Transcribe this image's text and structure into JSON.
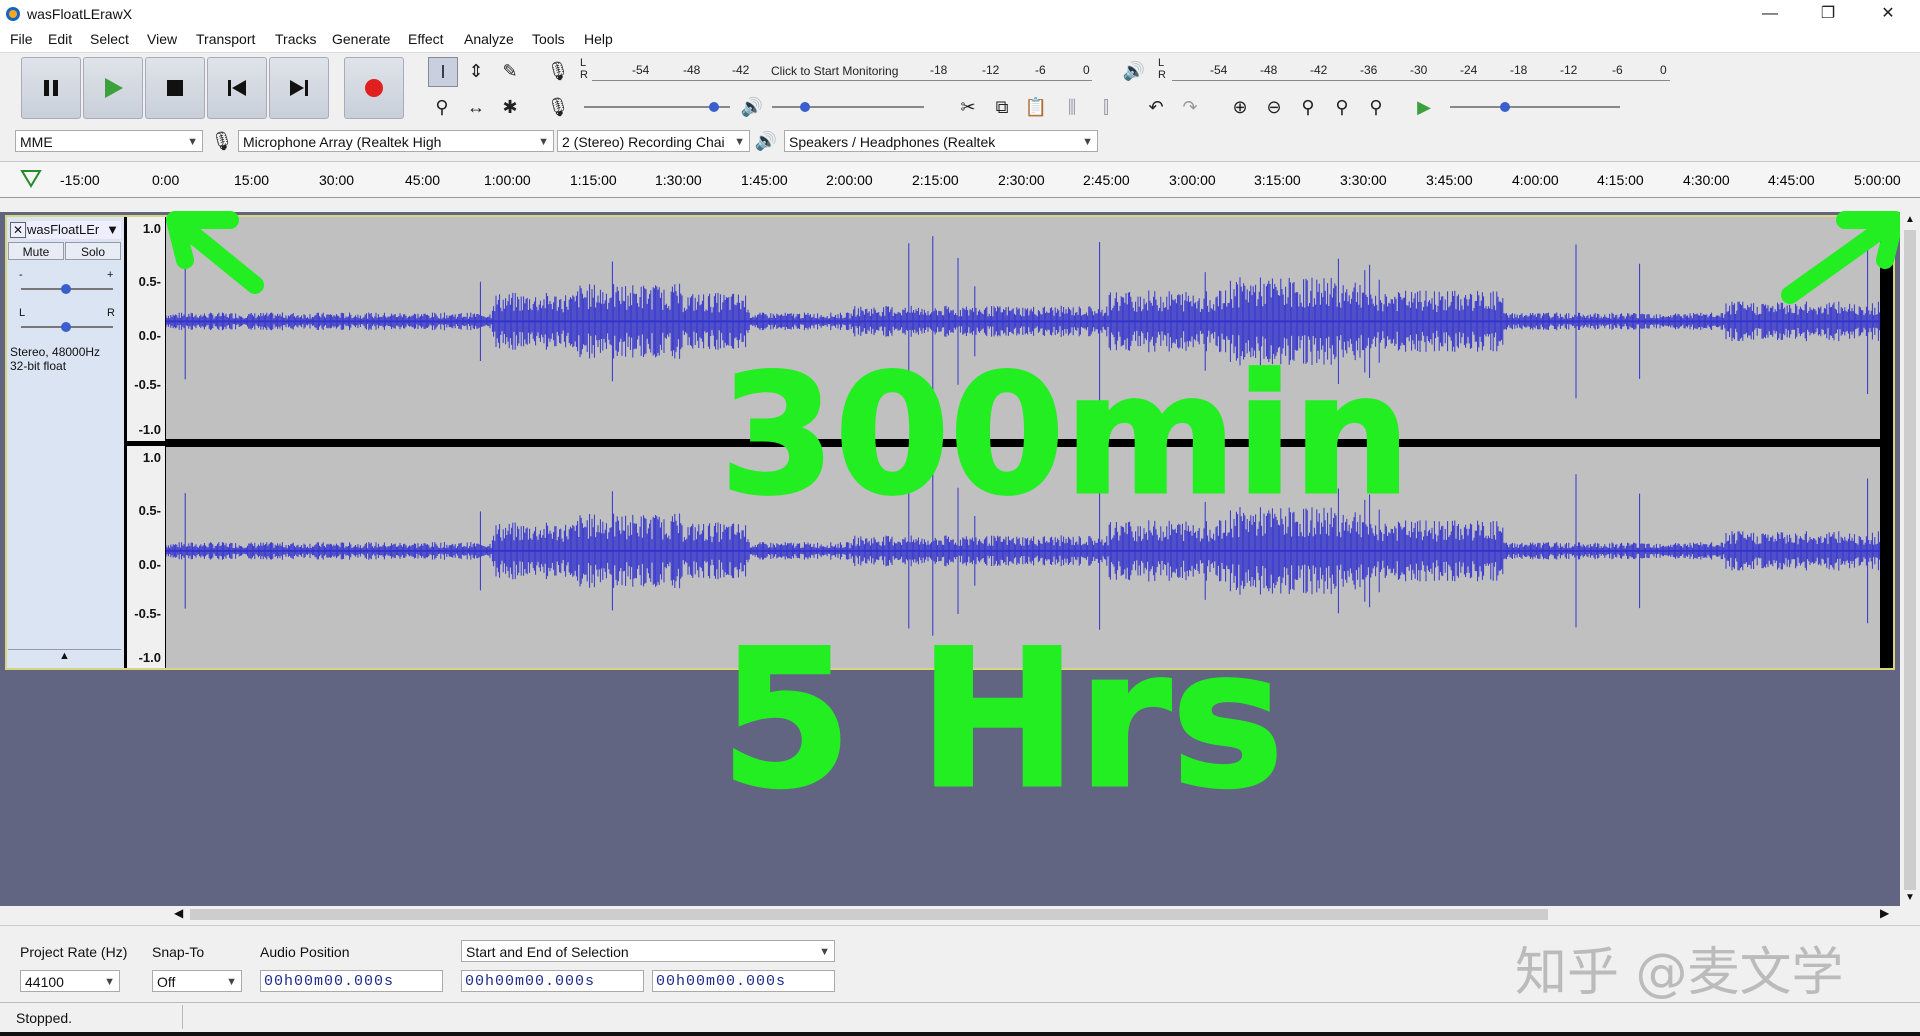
{
  "window": {
    "title": "wasFloatLErawX",
    "minimize": "—",
    "maximize": "❐",
    "close": "✕"
  },
  "menu": [
    "File",
    "Edit",
    "Select",
    "View",
    "Transport",
    "Tracks",
    "Generate",
    "Effect",
    "Analyze",
    "Tools",
    "Help"
  ],
  "transport": {
    "pause": "pause-icon",
    "play": "play-icon",
    "stop": "stop-icon",
    "skip_start": "skip-start-icon",
    "skip_end": "skip-end-icon",
    "record": "record-icon"
  },
  "meters": {
    "record_ticks": [
      "-54",
      "-48",
      "-42"
    ],
    "monitor_text": "Click to Start Monitoring",
    "record_ticks2": [
      "-18",
      "-12",
      "-6",
      "0"
    ],
    "play_ticks": [
      "-54",
      "-48",
      "-42",
      "-36",
      "-30",
      "-24",
      "-18",
      "-12",
      "-6",
      "0"
    ],
    "lr": [
      "L",
      "R"
    ]
  },
  "devices": {
    "host": "MME",
    "input": "Microphone Array (Realtek High",
    "channels": "2 (Stereo) Recording Chai",
    "output": "Speakers / Headphones (Realtek"
  },
  "ruler": [
    "-15:00",
    "0:00",
    "15:00",
    "30:00",
    "45:00",
    "1:00:00",
    "1:15:00",
    "1:30:00",
    "1:45:00",
    "2:00:00",
    "2:15:00",
    "2:30:00",
    "2:45:00",
    "3:00:00",
    "3:15:00",
    "3:30:00",
    "3:45:00",
    "4:00:00",
    "4:15:00",
    "4:30:00",
    "4:45:00",
    "5:00:00"
  ],
  "track": {
    "name": "wasFloatLEr",
    "mute": "Mute",
    "solo": "Solo",
    "gain_minus": "-",
    "gain_plus": "+",
    "pan_l": "L",
    "pan_r": "R",
    "info1": "Stereo, 48000Hz",
    "info2": "32-bit float",
    "vruler": [
      "1.0",
      "0.5-",
      "0.0-",
      "-0.5-",
      "-1.0"
    ],
    "wave_color": "#3333cc"
  },
  "annotations": {
    "line1": "300min",
    "line2": "5 Hrs"
  },
  "selection_toolbar": {
    "rate_label": "Project Rate (Hz)",
    "rate_value": "44100",
    "snap_label": "Snap-To",
    "snap_value": "Off",
    "audio_pos_label": "Audio Position",
    "sel_label": "Start and End of Selection",
    "time1": "00h00m00.000s",
    "time2": "00h00m00.000s",
    "time3": "00h00m00.000s"
  },
  "status": "Stopped.",
  "watermark": "知乎 @麦文学"
}
